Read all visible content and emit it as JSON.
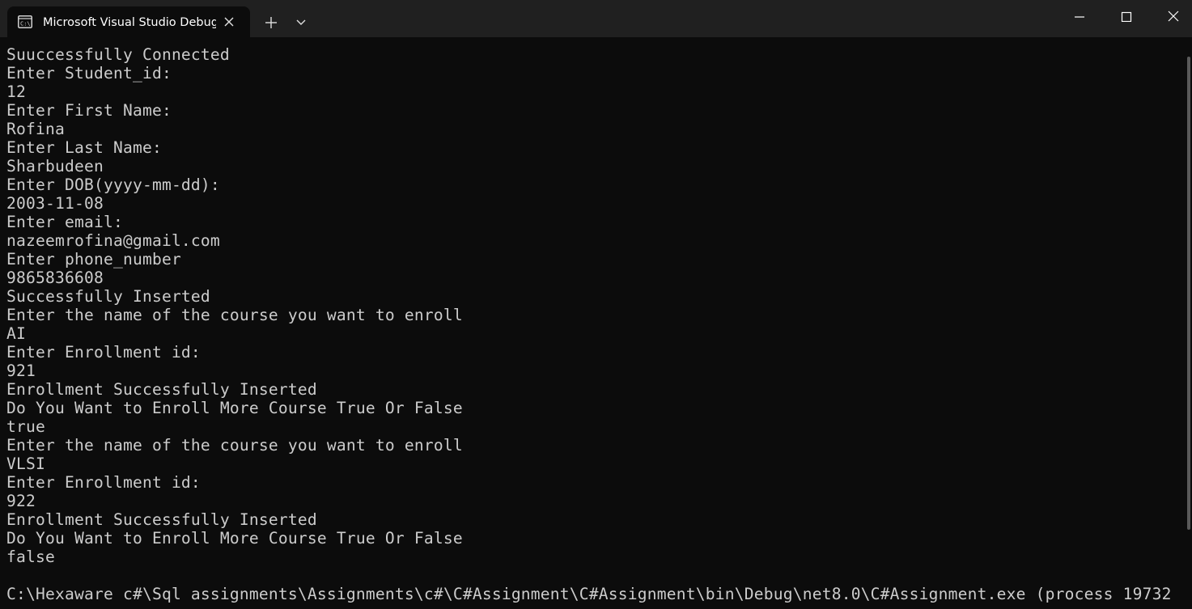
{
  "tab": {
    "title": "Microsoft Visual Studio Debug Console",
    "icon": "terminal-icon"
  },
  "window_controls": {
    "minimize_icon": "minimize-icon",
    "maximize_icon": "maximize-icon",
    "close_icon": "close-icon"
  },
  "console": {
    "lines": [
      "Suuccessfully Connected",
      "Enter Student_id:",
      "12",
      "Enter First Name:",
      "Rofina",
      "Enter Last Name:",
      "Sharbudeen",
      "Enter DOB(yyyy-mm-dd):",
      "2003-11-08",
      "Enter email:",
      "nazeemrofina@gmail.com",
      "Enter phone_number",
      "9865836608",
      "Successfully Inserted",
      "Enter the name of the course you want to enroll",
      "AI",
      "Enter Enrollment id:",
      "921",
      "Enrollment Successfully Inserted",
      "Do You Want to Enroll More Course True Or False",
      "true",
      "Enter the name of the course you want to enroll",
      "VLSI",
      "Enter Enrollment id:",
      "922",
      "Enrollment Successfully Inserted",
      "Do You Want to Enroll More Course True Or False",
      "false",
      "",
      "C:\\Hexaware c#\\Sql assignments\\Assignments\\c#\\C#Assignment\\C#Assignment\\bin\\Debug\\net8.0\\C#Assignment.exe (process 19732"
    ]
  }
}
